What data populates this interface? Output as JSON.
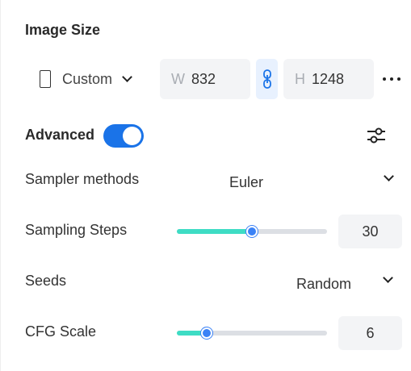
{
  "image_size": {
    "title": "Image Size",
    "preset": {
      "label": "Custom",
      "icon": "portrait-phone-icon"
    },
    "width": {
      "letter": "W",
      "value": "832"
    },
    "height": {
      "letter": "H",
      "value": "1248"
    },
    "link_icon": "chain-link-icon",
    "more_icon": "more-horizontal-icon"
  },
  "advanced": {
    "label": "Advanced",
    "enabled": true,
    "toggle_color": "#1a73e8",
    "settings_icon": "sliders-settings-icon"
  },
  "sampler": {
    "label": "Sampler methods",
    "value": "Euler"
  },
  "sampling_steps": {
    "label": "Sampling Steps",
    "value": "30",
    "fill_fraction": 0.5
  },
  "seeds": {
    "label": "Seeds",
    "value": "Random"
  },
  "cfg_scale": {
    "label": "CFG Scale",
    "value": "6",
    "fill_fraction": 0.2
  },
  "colors": {
    "accent": "#3b82f6",
    "slider_fill": "#3edcc4",
    "input_bg": "#f3f4f6"
  }
}
